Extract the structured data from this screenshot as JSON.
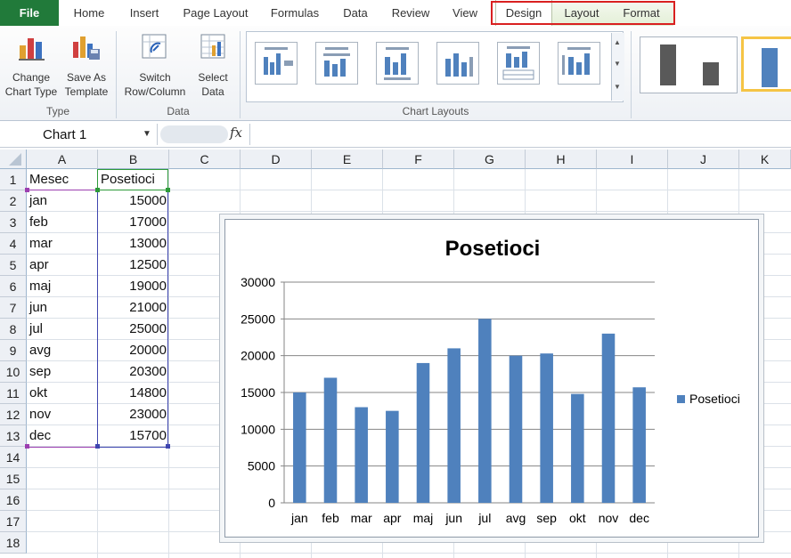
{
  "ribbon_tabs": {
    "file": "File",
    "home": "Home",
    "insert": "Insert",
    "page_layout": "Page Layout",
    "formulas": "Formulas",
    "data": "Data",
    "review": "Review",
    "view": "View",
    "design": "Design",
    "layout": "Layout",
    "format": "Format"
  },
  "ribbon": {
    "change_chart_type": [
      "Change",
      "Chart Type"
    ],
    "save_as_template": [
      "Save As",
      "Template"
    ],
    "switch_row_column": [
      "Switch",
      "Row/Column"
    ],
    "select_data": [
      "Select",
      "Data"
    ],
    "groups": {
      "type": "Type",
      "data": "Data",
      "chart_layouts": "Chart Layouts"
    }
  },
  "formula_bar": {
    "name_box": "Chart 1",
    "fx": "fx",
    "formula": ""
  },
  "sheet": {
    "columns": [
      "A",
      "B",
      "C",
      "D",
      "E",
      "F",
      "G",
      "H",
      "I",
      "J",
      "K"
    ],
    "rows": [
      "1",
      "2",
      "3",
      "4",
      "5",
      "6",
      "7",
      "8",
      "9",
      "10",
      "11",
      "12",
      "13",
      "14",
      "15",
      "16",
      "17",
      "18"
    ],
    "header": {
      "a": "Mesec",
      "b": "Posetioci"
    },
    "data": [
      {
        "month": "jan",
        "value": "15000"
      },
      {
        "month": "feb",
        "value": "17000"
      },
      {
        "month": "mar",
        "value": "13000"
      },
      {
        "month": "apr",
        "value": "12500"
      },
      {
        "month": "maj",
        "value": "19000"
      },
      {
        "month": "jun",
        "value": "21000"
      },
      {
        "month": "jul",
        "value": "25000"
      },
      {
        "month": "avg",
        "value": "20000"
      },
      {
        "month": "sep",
        "value": "20300"
      },
      {
        "month": "okt",
        "value": "14800"
      },
      {
        "month": "nov",
        "value": "23000"
      },
      {
        "month": "dec",
        "value": "15700"
      }
    ]
  },
  "colors": {
    "bar": "#4f81bd",
    "file_tab": "#217a3a",
    "highlight_box": "#d92020"
  },
  "chart_data": {
    "type": "bar",
    "title": "Posetioci",
    "categories": [
      "jan",
      "feb",
      "mar",
      "apr",
      "maj",
      "jun",
      "jul",
      "avg",
      "sep",
      "okt",
      "nov",
      "dec"
    ],
    "series": [
      {
        "name": "Posetioci",
        "values": [
          15000,
          17000,
          13000,
          12500,
          19000,
          21000,
          25000,
          20000,
          20300,
          14800,
          23000,
          15700
        ]
      }
    ],
    "yticks": [
      "0",
      "5000",
      "10000",
      "15000",
      "20000",
      "25000",
      "30000"
    ],
    "ylim": [
      0,
      30000
    ],
    "grid": true,
    "legend": "right"
  }
}
